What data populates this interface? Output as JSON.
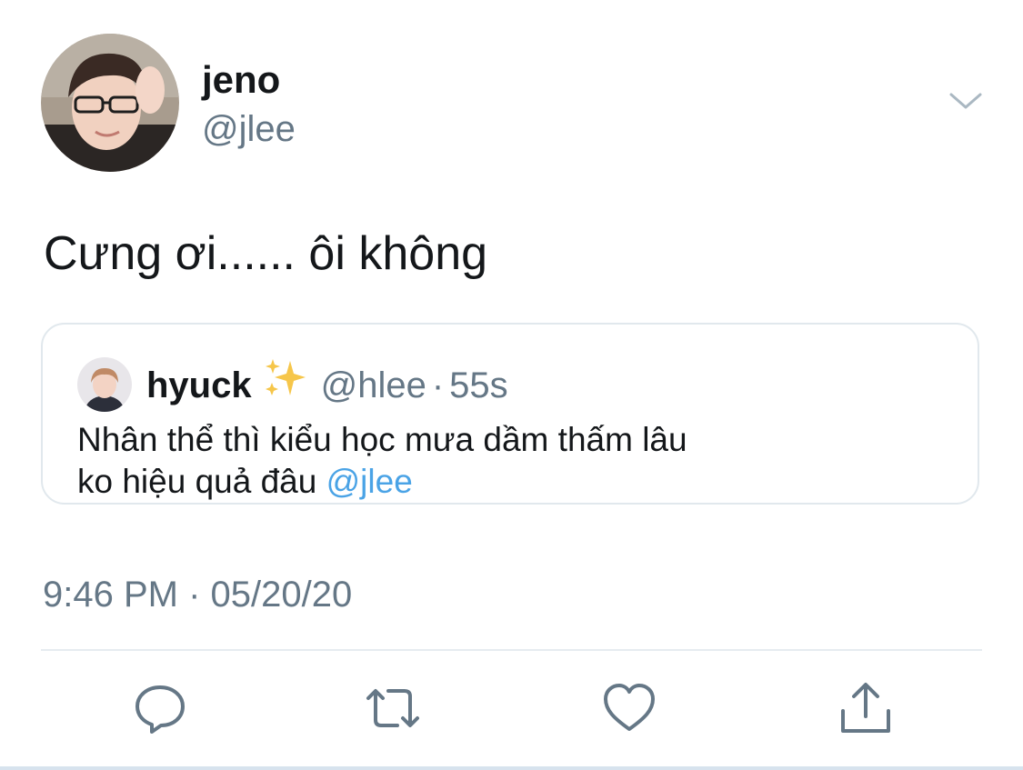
{
  "tweet": {
    "author": {
      "display_name": "jeno",
      "handle": "@jlee"
    },
    "text": "Cưng ơi...... ôi không",
    "timestamp": "9:46 PM · 05/20/20"
  },
  "quoted_tweet": {
    "display_name": "hyuck",
    "emoji": "sparkles",
    "handle": "@hlee",
    "separator": "·",
    "time": "55s",
    "text_line1": "Nhân thể thì kiểu học mưa dầm thấm lâu",
    "text_line2_prefix": "ko hiệu quả đâu ",
    "mention": "@jlee"
  },
  "icons": {
    "more": "chevron-down-icon",
    "reply": "reply-bubble-icon",
    "retweet": "retweet-icon",
    "like": "heart-icon",
    "share": "share-icon"
  },
  "colors": {
    "primary_text": "#14171a",
    "secondary_text": "#657786",
    "link": "#4aa3e6",
    "border": "#e1e8ed"
  }
}
